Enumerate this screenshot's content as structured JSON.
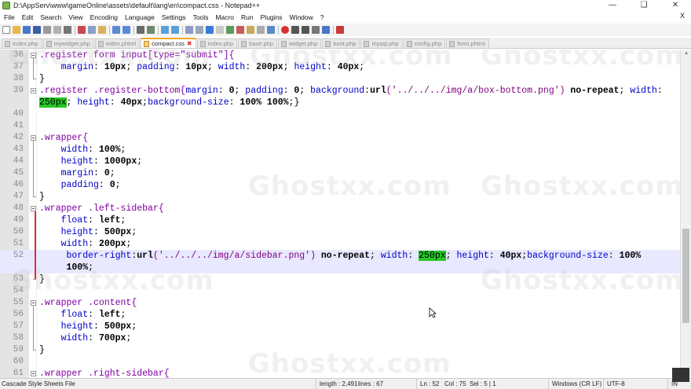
{
  "window": {
    "title": "D:\\AppServ\\www\\gameOnline\\assets\\default\\lang\\en\\compact.css - Notepad++",
    "minimize": "—",
    "maximize": "❑",
    "close": "✕"
  },
  "menu": [
    "File",
    "Edit",
    "Search",
    "View",
    "Encoding",
    "Language",
    "Settings",
    "Tools",
    "Macro",
    "Run",
    "Plugins",
    "Window",
    "?"
  ],
  "menu_close": "X",
  "tabs": [
    {
      "label": "index.php",
      "active": false
    },
    {
      "label": "mywidget.php",
      "active": false
    },
    {
      "label": "index.phtml",
      "active": false
    },
    {
      "label": "compact.css",
      "active": true
    },
    {
      "label": "index.php",
      "active": false
    },
    {
      "label": "base.php",
      "active": false
    },
    {
      "label": "widget.php",
      "active": false
    },
    {
      "label": "boot.php",
      "active": false
    },
    {
      "label": "mysql.php",
      "active": false
    },
    {
      "label": "config.php",
      "active": false
    },
    {
      "label": "form.phtml",
      "active": false
    }
  ],
  "tab_close": "✖",
  "editor": {
    "lines": [
      {
        "n": "36",
        "tokens": [
          [
            ".register ",
            "sel"
          ],
          [
            "form ",
            "kw2"
          ],
          [
            "input",
            "kw2"
          ],
          [
            "[type=\"submit\"]{",
            "sel"
          ]
        ]
      },
      {
        "n": "37",
        "tokens": [
          [
            "    margin",
            "prop"
          ],
          [
            ": ",
            "p"
          ],
          [
            "10px",
            "val"
          ],
          [
            "; ",
            "p"
          ],
          [
            "padding",
            "prop"
          ],
          [
            ": ",
            "p"
          ],
          [
            "10px",
            "val"
          ],
          [
            "; ",
            "p"
          ],
          [
            "width",
            "prop"
          ],
          [
            ": ",
            "p"
          ],
          [
            "200px",
            "val"
          ],
          [
            "; ",
            "p"
          ],
          [
            "height",
            "prop"
          ],
          [
            ": ",
            "p"
          ],
          [
            "40px",
            "val"
          ],
          [
            ";",
            "p"
          ]
        ]
      },
      {
        "n": "38",
        "tokens": [
          [
            "}",
            "p"
          ]
        ]
      },
      {
        "n": "39",
        "tokens": [
          [
            ".register .register-bottom{",
            "sel"
          ],
          [
            "margin",
            "prop"
          ],
          [
            ": ",
            "p"
          ],
          [
            "0",
            "val"
          ],
          [
            "; ",
            "p"
          ],
          [
            "padding",
            "prop"
          ],
          [
            ": ",
            "p"
          ],
          [
            "0",
            "val"
          ],
          [
            "; ",
            "p"
          ],
          [
            "background",
            "prop"
          ],
          [
            ":",
            "p"
          ],
          [
            "url",
            "val"
          ],
          [
            "('../../../img/a/box-bottom.png')",
            "str"
          ],
          [
            " no-repeat",
            "val"
          ],
          [
            "; ",
            "p"
          ],
          [
            "width",
            "prop"
          ],
          [
            ":",
            "p"
          ]
        ]
      },
      {
        "n": "",
        "tokens": [
          [
            "250px",
            "hit"
          ],
          [
            "; ",
            "p"
          ],
          [
            "height",
            "prop"
          ],
          [
            ": ",
            "p"
          ],
          [
            "40px",
            "val"
          ],
          [
            ";",
            "p"
          ],
          [
            "background-size",
            "prop"
          ],
          [
            ": ",
            "p"
          ],
          [
            "100% 100%",
            "val"
          ],
          [
            ";}",
            "p"
          ]
        ]
      },
      {
        "n": "40",
        "tokens": []
      },
      {
        "n": "41",
        "tokens": []
      },
      {
        "n": "42",
        "tokens": [
          [
            ".wrapper{",
            "sel"
          ]
        ]
      },
      {
        "n": "43",
        "tokens": [
          [
            "    width",
            "prop"
          ],
          [
            ": ",
            "p"
          ],
          [
            "100%",
            "val"
          ],
          [
            ";",
            "p"
          ]
        ]
      },
      {
        "n": "44",
        "tokens": [
          [
            "    height",
            "prop"
          ],
          [
            ": ",
            "p"
          ],
          [
            "1000px",
            "val"
          ],
          [
            ";",
            "p"
          ]
        ]
      },
      {
        "n": "45",
        "tokens": [
          [
            "    margin",
            "prop"
          ],
          [
            ": ",
            "p"
          ],
          [
            "0",
            "val"
          ],
          [
            ";",
            "p"
          ]
        ]
      },
      {
        "n": "46",
        "tokens": [
          [
            "    padding",
            "prop"
          ],
          [
            ": ",
            "p"
          ],
          [
            "0",
            "val"
          ],
          [
            ";",
            "p"
          ]
        ]
      },
      {
        "n": "47",
        "tokens": [
          [
            "}",
            "p"
          ]
        ]
      },
      {
        "n": "48",
        "tokens": [
          [
            ".wrapper .left-sidebar{",
            "sel"
          ]
        ]
      },
      {
        "n": "49",
        "tokens": [
          [
            "    float",
            "prop"
          ],
          [
            ": ",
            "p"
          ],
          [
            "left",
            "val"
          ],
          [
            ";",
            "p"
          ]
        ]
      },
      {
        "n": "50",
        "tokens": [
          [
            "    height",
            "prop"
          ],
          [
            ": ",
            "p"
          ],
          [
            "500px",
            "val"
          ],
          [
            ";",
            "p"
          ]
        ]
      },
      {
        "n": "51",
        "tokens": [
          [
            "    width",
            "prop"
          ],
          [
            ": ",
            "p"
          ],
          [
            "200px",
            "val"
          ],
          [
            ";",
            "p"
          ]
        ]
      },
      {
        "n": "52",
        "tokens": [
          [
            "     border-right",
            "prop"
          ],
          [
            ":",
            "p"
          ],
          [
            "url",
            "val"
          ],
          [
            "('../../../img/a/sidebar.png')",
            "str"
          ],
          [
            " no-repeat",
            "val"
          ],
          [
            "; ",
            "p"
          ],
          [
            "width",
            "prop"
          ],
          [
            ": ",
            "p"
          ],
          [
            "250px",
            "hit"
          ],
          [
            "; ",
            "p"
          ],
          [
            "height",
            "prop"
          ],
          [
            ": ",
            "p"
          ],
          [
            "40px",
            "val"
          ],
          [
            ";",
            "p"
          ],
          [
            "background-size",
            "prop"
          ],
          [
            ": ",
            "p"
          ],
          [
            "100%",
            "val"
          ]
        ]
      },
      {
        "n": "",
        "tokens": [
          [
            "     100%",
            "val"
          ],
          [
            ";",
            "p"
          ]
        ]
      },
      {
        "n": "53",
        "tokens": [
          [
            "}",
            "p"
          ]
        ]
      },
      {
        "n": "54",
        "tokens": []
      },
      {
        "n": "55",
        "tokens": [
          [
            ".wrapper .content{",
            "sel"
          ]
        ]
      },
      {
        "n": "56",
        "tokens": [
          [
            "    float",
            "prop"
          ],
          [
            ": ",
            "p"
          ],
          [
            "left",
            "val"
          ],
          [
            ";",
            "p"
          ]
        ]
      },
      {
        "n": "57",
        "tokens": [
          [
            "    height",
            "prop"
          ],
          [
            ": ",
            "p"
          ],
          [
            "500px",
            "val"
          ],
          [
            ";",
            "p"
          ]
        ]
      },
      {
        "n": "58",
        "tokens": [
          [
            "    width",
            "prop"
          ],
          [
            ": ",
            "p"
          ],
          [
            "700px",
            "val"
          ],
          [
            ";",
            "p"
          ]
        ]
      },
      {
        "n": "59",
        "tokens": [
          [
            "}",
            "p"
          ]
        ]
      },
      {
        "n": "60",
        "tokens": []
      },
      {
        "n": "61",
        "tokens": [
          [
            ".wrapper .right-sidebar{",
            "sel"
          ]
        ]
      }
    ]
  },
  "status": {
    "filetype": "Cascade Style Sheets File",
    "length": "length : 2,491",
    "lines": "lines : 67",
    "ln": "Ln : 52",
    "col": "Col : 75",
    "sel": "Sel : 5 | 1",
    "eol": "Windows (CR LF)",
    "encoding": "UTF-8",
    "ins": "IN"
  },
  "watermark": "Ghostxx.com",
  "colors": {
    "accent_tab": "#f5a623",
    "highlight": "#26c826",
    "current_line": "#e8e8ff",
    "selector": "#8000a0",
    "property": "#0000c8"
  }
}
